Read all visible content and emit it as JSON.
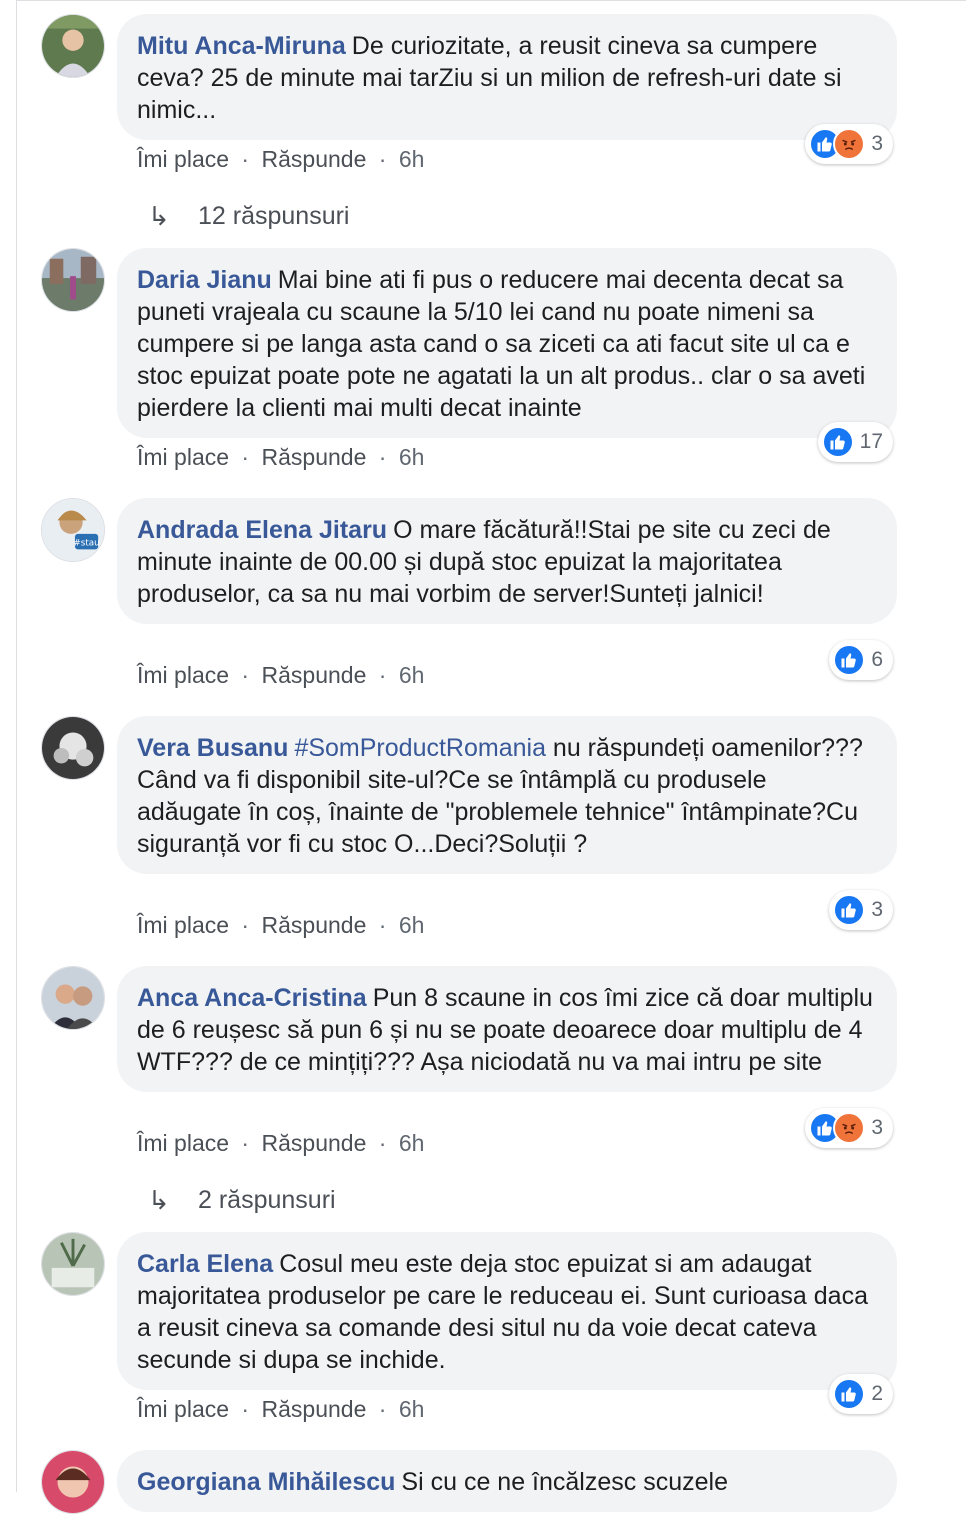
{
  "comments": [
    {
      "author": "Mitu Anca-Miruna",
      "text": "De curiozitate, a reusit cineva sa cumpere ceva? 25 de minute mai tarZiu si un milion de refresh-uri date si nimic...",
      "like_label": "Îmi place",
      "reply_label": "Răspunde",
      "time": "6h",
      "reaction_count": "3",
      "reactions": [
        "like",
        "angry"
      ],
      "replies_label": "12 răspunsuri"
    },
    {
      "author": "Daria Jianu",
      "text": "Mai bine ati fi pus o reducere mai decenta decat sa puneti vrajeala cu scaune la 5/10 lei cand nu poate nimeni sa cumpere si pe langa asta cand o sa ziceti ca ati facut site ul ca e stoc epuizat poate pote ne agatati la un alt produs.. clar o sa aveti pierdere la clienti mai multi decat inainte",
      "like_label": "Îmi place",
      "reply_label": "Răspunde",
      "time": "6h",
      "reaction_count": "17",
      "reactions": [
        "like"
      ]
    },
    {
      "author": "Andrada Elena Jitaru",
      "text": "O mare făcătură!!Stai pe site cu zeci de minute inainte de 00.00 și după stoc epuizat la majoritatea produselor, ca sa nu mai vorbim de server!Sunteți jalnici!",
      "like_label": "Îmi place",
      "reply_label": "Răspunde",
      "time": "6h",
      "reaction_count": "6",
      "reactions": [
        "like"
      ]
    },
    {
      "author": "Vera Busanu",
      "hashtag": "#SomProductRomania",
      "text": "nu răspundeți oamenilor???Când va fi disponibil site-ul?Ce se întâmplă cu produsele adăugate în coș, înainte de \"problemele tehnice\" întâmpinate?Cu siguranță vor fi cu stoc O...Deci?Soluții ?",
      "like_label": "Îmi place",
      "reply_label": "Răspunde",
      "time": "6h",
      "reaction_count": "3",
      "reactions": [
        "like"
      ]
    },
    {
      "author": "Anca Anca-Cristina",
      "text": "Pun 8 scaune in cos îmi zice că doar multiplu de 6 reușesc să pun 6 și nu se poate deoarece doar multiplu de 4 WTF??? de ce mințiți??? Așa niciodată nu va mai intru pe site",
      "like_label": "Îmi place",
      "reply_label": "Răspunde",
      "time": "6h",
      "reaction_count": "3",
      "reactions": [
        "like",
        "angry"
      ],
      "replies_label": "2 răspunsuri"
    },
    {
      "author": "Carla Elena",
      "text": "Cosul meu este deja stoc epuizat si am adaugat majoritatea produselor pe care le reduceau ei. Sunt curioasa daca a reusit cineva sa comande desi situl nu da voie decat cateva secunde si dupa se inchide.",
      "like_label": "Îmi place",
      "reply_label": "Răspunde",
      "time": "6h",
      "reaction_count": "2",
      "reactions": [
        "like"
      ]
    },
    {
      "author": "Georgiana Mihăilescu",
      "text": "Si cu ce ne încălzesc scuzele"
    }
  ],
  "icons": {
    "like": "thumbs-up-icon",
    "angry": "angry-face-icon",
    "reply_arrow": "reply-arrow-icon"
  },
  "colors": {
    "author": "#385898",
    "like": "#1877f2",
    "angry": "#f0743a",
    "bubble": "#f2f3f5"
  }
}
